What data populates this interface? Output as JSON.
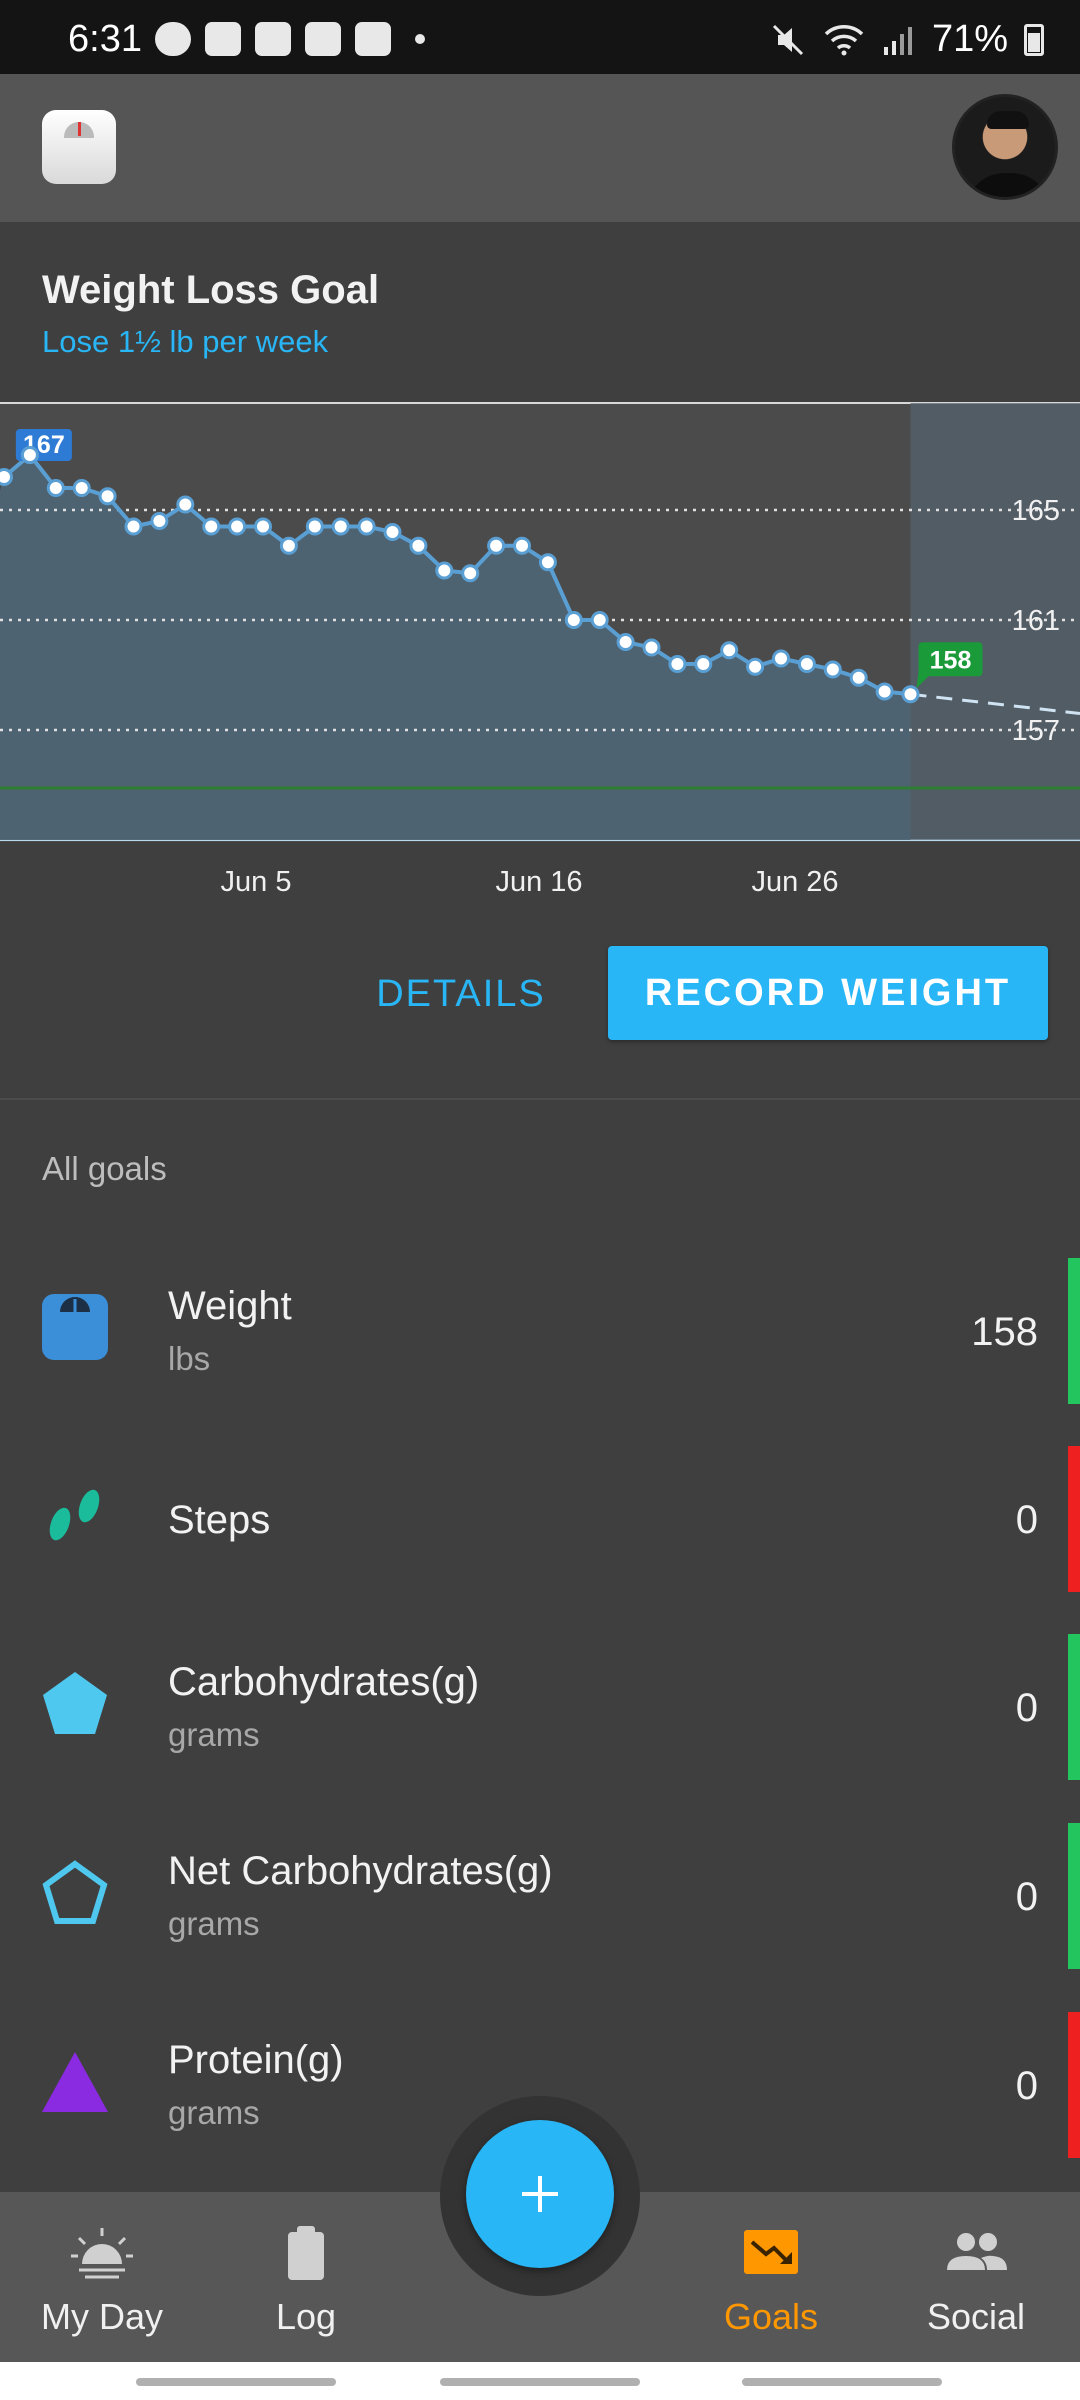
{
  "status_bar": {
    "time": "6:31",
    "battery": "71%"
  },
  "goal": {
    "title": "Weight Loss Goal",
    "subtitle": "Lose 1½ lb per week"
  },
  "chart_data": {
    "type": "line",
    "x_labels": [
      "Jun 5",
      "Jun 16",
      "Jun 26"
    ],
    "y_reference_lines": [
      165,
      161,
      157
    ],
    "start_label": "167",
    "current_label": "158",
    "weights": [
      166.2,
      167,
      165.8,
      165.8,
      165.5,
      164.4,
      164.6,
      165.2,
      164.4,
      164.4,
      164.4,
      163.7,
      164.4,
      164.4,
      164.4,
      164.2,
      163.7,
      162.8,
      162.7,
      163.7,
      163.7,
      163.1,
      161,
      161,
      160.2,
      160,
      159.4,
      159.4,
      159.9,
      159.3,
      159.6,
      159.4,
      159.2,
      158.9,
      158.4,
      158.3
    ],
    "trend_projection": [
      158.3,
      157.6
    ],
    "grid": true,
    "colors": {
      "line": "#5a9fd4",
      "fill": "#4d6474",
      "start_badge": "#2e7bd6",
      "current_badge": "#1b9a3a",
      "goal_line": "#2e7d32"
    }
  },
  "actions": {
    "details": "DETAILS",
    "record_weight": "RECORD WEIGHT"
  },
  "all_goals_label": "All goals",
  "goals": [
    {
      "name": "Weight",
      "unit": "lbs",
      "value": "158",
      "icon": "scale-icon",
      "status_color": "#22c55e"
    },
    {
      "name": "Steps",
      "unit": "",
      "value": "0",
      "icon": "footprints-icon",
      "status_color": "#ef2020"
    },
    {
      "name": "Carbohydrates(g)",
      "unit": "grams",
      "value": "0",
      "icon": "filled-pentagon-icon",
      "status_color": "#22c55e"
    },
    {
      "name": "Net Carbohydrates(g)",
      "unit": "grams",
      "value": "0",
      "icon": "outline-pentagon-icon",
      "status_color": "#22c55e"
    },
    {
      "name": "Protein(g)",
      "unit": "grams",
      "value": "0",
      "icon": "triangle-icon",
      "status_color": "#ef2020"
    }
  ],
  "nav": {
    "my_day": "My Day",
    "log": "Log",
    "goals": "Goals",
    "social": "Social",
    "active": "goals"
  }
}
